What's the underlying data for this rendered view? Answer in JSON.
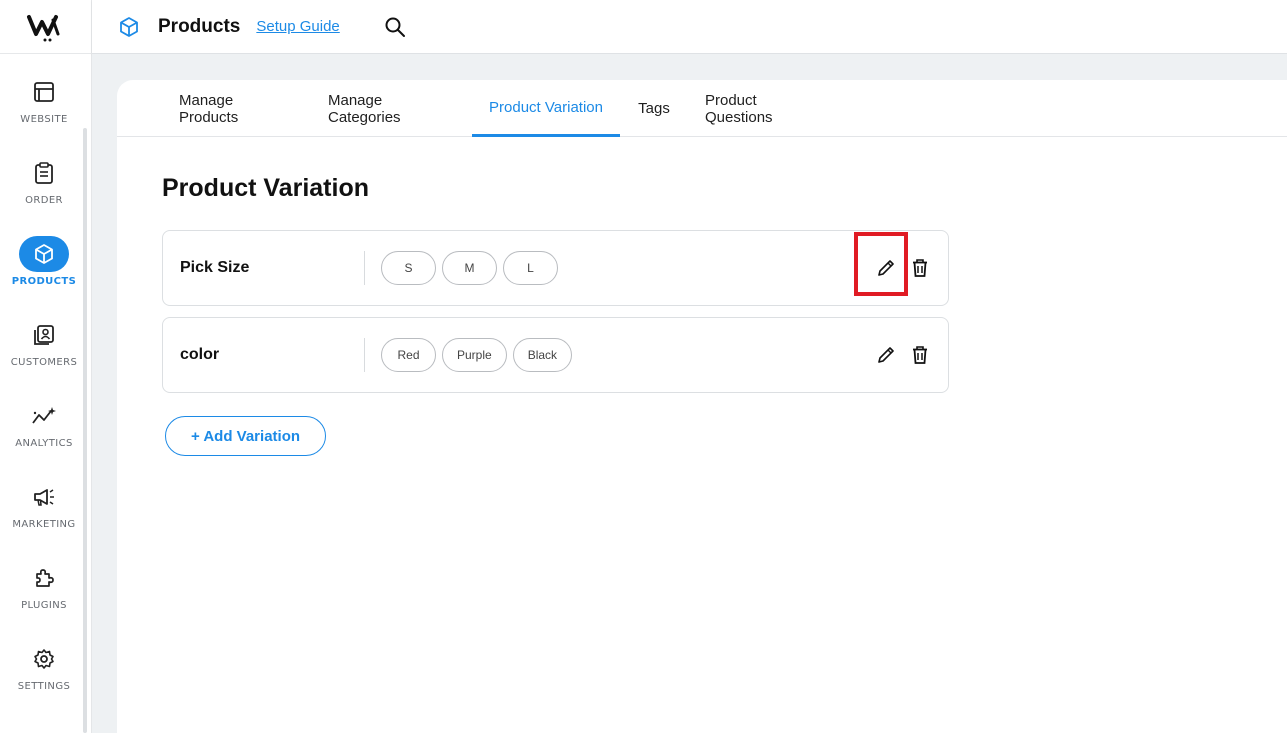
{
  "sidebar": {
    "items": [
      {
        "label": "WEBSITE",
        "icon": "browser-window-icon"
      },
      {
        "label": "ORDER",
        "icon": "clipboard-icon"
      },
      {
        "label": "PRODUCTS",
        "icon": "cube-icon",
        "active": true
      },
      {
        "label": "CUSTOMERS",
        "icon": "contact-book-icon"
      },
      {
        "label": "ANALYTICS",
        "icon": "sparkline-icon"
      },
      {
        "label": "MARKETING",
        "icon": "megaphone-icon"
      },
      {
        "label": "PLUGINS",
        "icon": "puzzle-icon"
      },
      {
        "label": "SETTINGS",
        "icon": "gear-icon"
      }
    ]
  },
  "header": {
    "title": "Products",
    "link": "Setup Guide"
  },
  "tabs": [
    {
      "label": "Manage Products"
    },
    {
      "label": "Manage Categories"
    },
    {
      "label": "Product Variation",
      "active": true
    },
    {
      "label": "Tags"
    },
    {
      "label": "Product Questions"
    }
  ],
  "page": {
    "title": "Product Variation"
  },
  "variations": [
    {
      "name": "Pick Size",
      "options": [
        "S",
        "M",
        "L"
      ]
    },
    {
      "name": "color",
      "options": [
        "Red",
        "Purple",
        "Black"
      ]
    }
  ],
  "add_button": "+ Add Variation",
  "colors": {
    "accent": "#1c8ae6",
    "highlight": "#e01b24"
  }
}
